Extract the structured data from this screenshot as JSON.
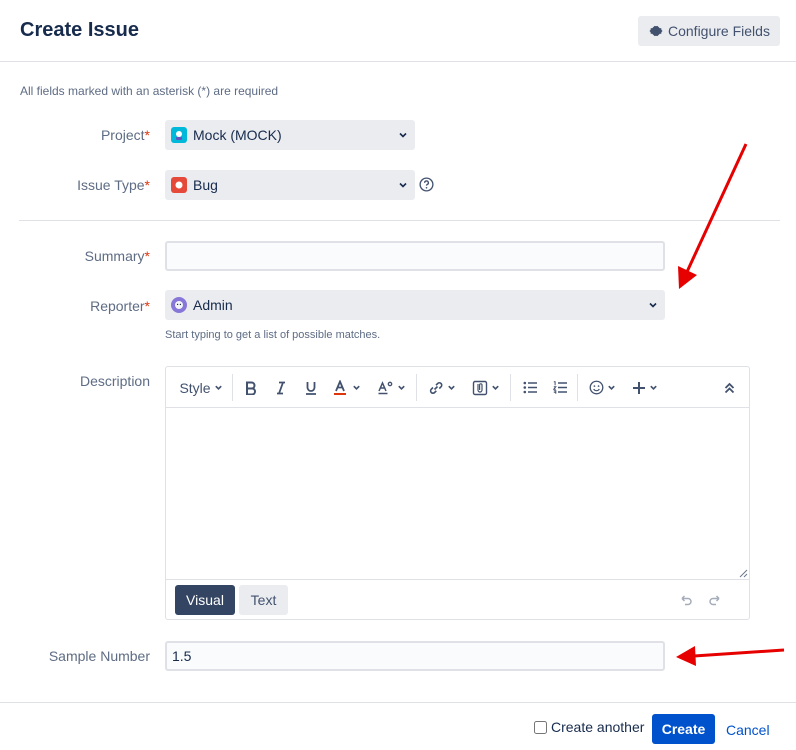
{
  "dialog": {
    "title": "Create Issue",
    "configure_fields_label": "Configure Fields",
    "required_note": "All fields marked with an asterisk (*) are required"
  },
  "fields": {
    "project": {
      "label": "Project",
      "asterisk": "*",
      "value": "Mock (MOCK)"
    },
    "issue_type": {
      "label": "Issue Type",
      "asterisk": "*",
      "value": "Bug"
    },
    "summary": {
      "label": "Summary",
      "asterisk": "*",
      "value": ""
    },
    "reporter": {
      "label": "Reporter",
      "asterisk": "*",
      "value": "Admin",
      "hint": "Start typing to get a list of possible matches."
    },
    "description": {
      "label": "Description"
    },
    "sample_number": {
      "label": "Sample Number",
      "value": "1.5"
    }
  },
  "editor": {
    "style_label": "Style",
    "visual_tab": "Visual",
    "text_tab": "Text",
    "toolbar_icons": [
      "bold-icon",
      "italic-icon",
      "underline-icon",
      "text-color-icon",
      "text-format-icon",
      "link-icon",
      "attachment-icon",
      "bullet-list-icon",
      "numbered-list-icon",
      "emoji-icon",
      "insert-plus-icon",
      "collapse-icon"
    ]
  },
  "footer": {
    "create_another_label": "Create another",
    "create_label": "Create",
    "cancel_label": "Cancel"
  },
  "colors": {
    "primary": "#0052cc",
    "required": "#de350b",
    "annotation_arrow": "#e60000",
    "bug": "#e5493a"
  }
}
